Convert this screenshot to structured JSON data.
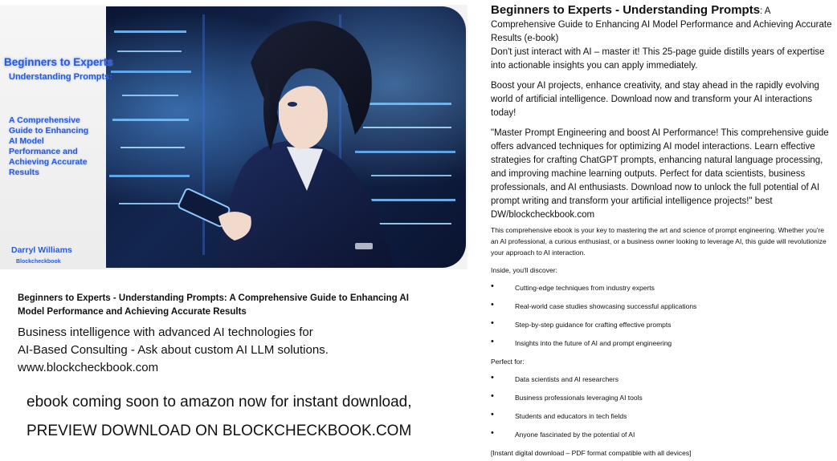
{
  "cover": {
    "title_line1": "Beginners to Experts",
    "title_line2": "Understanding Prompts:",
    "subtitle": "A Comprehensive Guide to Enhancing AI Model Performance and Achieving Accurate Results",
    "author": "Darryl Williams",
    "brand": "Blockcheckbook"
  },
  "left": {
    "title": "Beginners to Experts - Understanding Prompts: A Comprehensive Guide to Enhancing AI Model Performance and Achieving Accurate Results",
    "line1": "Business intelligence with advanced AI technologies for",
    "line2": "AI-Based Consulting - Ask about custom AI LLM solutions.",
    "line3": "www.blockcheckbook.com",
    "soon": "ebook coming soon to amazon now for instant download,",
    "preview": "PREVIEW DOWNLOAD ON BLOCKCHECKBOOK.COM"
  },
  "right": {
    "heading_bold": "Beginners to Experts - Understanding Prompts",
    "heading_rest": ": A Comprehensive Guide to Enhancing AI Model Performance and Achieving Accurate Results (e-book)",
    "p1": "Don't just interact with AI – master it! This 25-page guide distills years of expertise into actionable insights you can apply immediately.",
    "p2": "Boost your AI projects, enhance creativity, and stay ahead in the rapidly evolving world of artificial intelligence. Download now and transform your AI interactions today!",
    "p3": "\"Master Prompt Engineering and boost AI Performance! This comprehensive guide offers advanced techniques for optimizing AI model interactions. Learn effective strategies for crafting ChatGPT prompts, enhancing natural language processing, and improving machine learning outputs. Perfect for data scientists, business professionals, and AI enthusiasts. Download now to unlock the full potential of AI prompt writing and transform your artificial intelligence projects!\" best DW/blockcheckbook.com",
    "p4": "This comprehensive ebook is your key to mastering the art and science of prompt engineering. Whether you're an AI professional, a curious enthusiast, or a business owner looking to leverage AI, this guide will revolutionize your approach to AI interaction.",
    "inside_label": "Inside, you'll discover:",
    "inside_items": [
      "Cutting-edge techniques from industry experts",
      "Real-world case studies showcasing successful applications",
      "Step-by-step guidance for crafting effective prompts",
      "Insights into the future of AI and prompt engineering"
    ],
    "perfect_label": "Perfect for:",
    "perfect_items": [
      "Data scientists and AI researchers",
      "Business professionals leveraging AI tools",
      "Students and educators in tech fields",
      "Anyone fascinated by the potential of AI"
    ],
    "footer": "[Instant digital download – PDF format compatible with all devices]",
    "bullet_glyph": "•"
  }
}
